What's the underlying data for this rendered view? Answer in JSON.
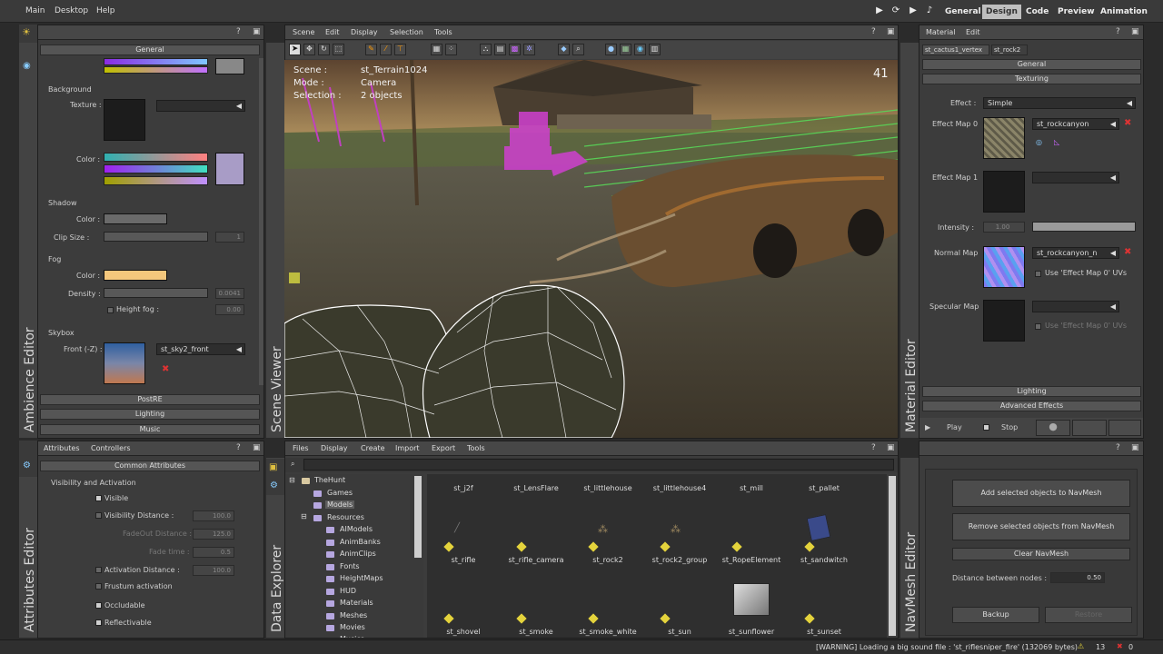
{
  "menubar": {
    "items": [
      "Main",
      "Desktop",
      "Help"
    ],
    "modes": [
      "General",
      "Design",
      "Code",
      "Preview",
      "Animation"
    ],
    "active_mode": "Design"
  },
  "ambience": {
    "tab_label": "Ambience Editor",
    "general": "General",
    "background": {
      "title": "Background",
      "texture": "Texture :",
      "color": "Color :"
    },
    "shadow": {
      "title": "Shadow",
      "color": "Color :",
      "clip": "Clip Size :",
      "clip_value": "1"
    },
    "fog": {
      "title": "Fog",
      "color": "Color :",
      "density": "Density :",
      "density_value": "0.0041",
      "height": "Height fog :",
      "height_value": "0.00"
    },
    "skybox": {
      "title": "Skybox",
      "front": "Front (-Z) :",
      "front_value": "st_sky2_front"
    },
    "footer": [
      "PostRE",
      "Lighting",
      "Music"
    ]
  },
  "scene": {
    "tab_label": "Scene Viewer",
    "menus": [
      "Scene",
      "Edit",
      "Display",
      "Selection",
      "Tools"
    ],
    "overlay": {
      "scene_k": "Scene :",
      "scene_v": "st_Terrain1024",
      "mode_k": "Mode :",
      "mode_v": "Camera",
      "sel_k": "Selection :",
      "sel_v": "2 objects",
      "fps": "41"
    }
  },
  "material": {
    "tab_label": "Material Editor",
    "menus": [
      "Material",
      "Edit"
    ],
    "tabs": [
      "st_cactus1_vertex",
      "st_rock2"
    ],
    "general": "General",
    "texturing": "Texturing",
    "effect": {
      "label": "Effect :",
      "value": "Simple"
    },
    "map0": {
      "label": "Effect Map 0",
      "value": "st_rockcanyon"
    },
    "map1": {
      "label": "Effect Map 1"
    },
    "intensity": {
      "label": "Intensity :",
      "value": "1.00"
    },
    "normal": {
      "label": "Normal Map",
      "value": "st_rockcanyon_n",
      "use": "Use 'Effect Map 0' UVs"
    },
    "specular": {
      "label": "Specular Map",
      "use": "Use 'Effect Map 0' UVs"
    },
    "footer": [
      "Lighting",
      "Advanced Effects"
    ],
    "play": "Play",
    "stop": "Stop"
  },
  "attributes": {
    "tab_label": "Attributes Editor",
    "menus": [
      "Attributes",
      "Controllers"
    ],
    "common": "Common Attributes",
    "visibility": "Visibility and Activation",
    "visible": "Visible",
    "vis_dist": "Visibility Distance :",
    "vis_dist_v": "100.0",
    "fadeout": "FadeOut Distance :",
    "fadeout_v": "125.0",
    "fadetime": "Fade time :",
    "fadetime_v": "0.5",
    "act_dist": "Activation Distance :",
    "act_dist_v": "100.0",
    "frustum": "Frustum activation",
    "occludable": "Occludable",
    "reflectivable": "Reflectivable"
  },
  "data": {
    "tab_label": "Data Explorer",
    "menus": [
      "Files",
      "Display",
      "Create",
      "Import",
      "Export",
      "Tools"
    ],
    "tree": [
      "TheHunt",
      "Games",
      "Models",
      "Resources",
      "AIModels",
      "AnimBanks",
      "AnimClips",
      "Fonts",
      "HeightMaps",
      "HUD",
      "Materials",
      "Meshes",
      "Movies",
      "Musics"
    ],
    "row1": [
      "st_j2f",
      "st_LensFlare",
      "st_littlehouse",
      "st_littlehouse4",
      "st_mill",
      "st_pallet"
    ],
    "row2": [
      "st_rifle",
      "st_rifle_camera",
      "st_rock2",
      "st_rock2_group",
      "st_RopeElement",
      "st_sandwitch"
    ],
    "row3": [
      "st_shovel",
      "st_smoke",
      "st_smoke_white",
      "st_sun",
      "st_sunflower",
      "st_sunset"
    ]
  },
  "navmesh": {
    "tab_label": "NavMesh Editor",
    "add": "Add selected objects to NavMesh",
    "remove": "Remove selected objects from NavMesh",
    "clear": "Clear NavMesh",
    "distance": "Distance between nodes :",
    "distance_v": "0.50",
    "backup": "Backup",
    "restore": "Restore"
  },
  "status": {
    "message": "[WARNING] Loading a big sound file : 'st_riflesniper_fire' (132069 bytes)",
    "warnings": "13",
    "errors": "0"
  }
}
